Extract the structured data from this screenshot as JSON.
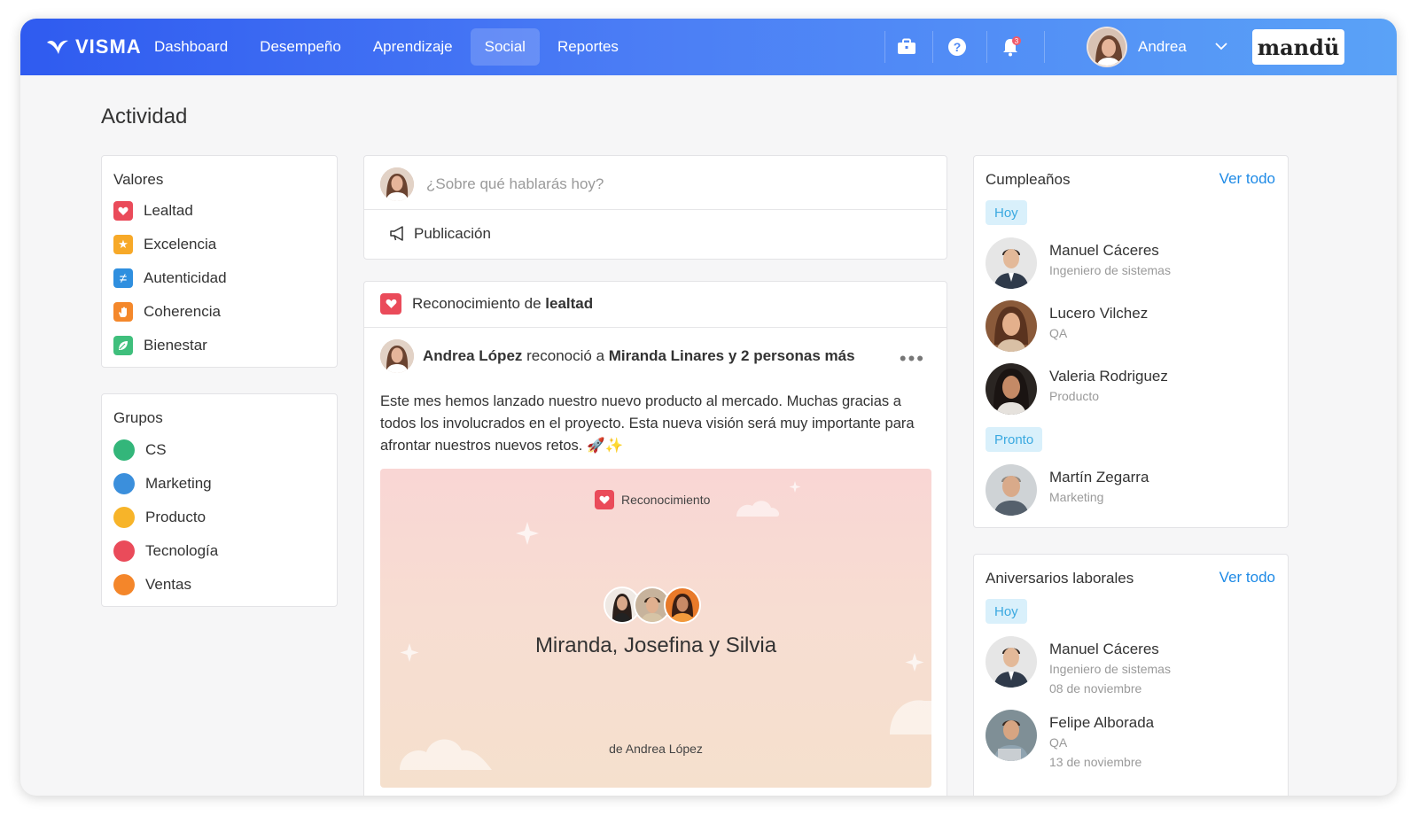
{
  "nav": {
    "brand": "VISMA",
    "links": [
      {
        "label": "Dashboard"
      },
      {
        "label": "Desempeño"
      },
      {
        "label": "Aprendizaje"
      },
      {
        "label": "Social"
      },
      {
        "label": "Reportes"
      }
    ],
    "active": "Social",
    "notification_count": "3",
    "user_name": "Andrea",
    "partner_logo": "mandü"
  },
  "page": {
    "title": "Actividad"
  },
  "valores": {
    "title": "Valores",
    "items": [
      {
        "label": "Lealtad",
        "icon": "heart-icon",
        "color": "#ea4b5a"
      },
      {
        "label": "Excelencia",
        "icon": "star-icon",
        "color": "#f7a928"
      },
      {
        "label": "Autenticidad",
        "icon": "not-equal-icon",
        "color": "#2f8fdf"
      },
      {
        "label": "Coherencia",
        "icon": "hand-icon",
        "color": "#f4882b"
      },
      {
        "label": "Bienestar",
        "icon": "leaf-icon",
        "color": "#3fbf7c"
      }
    ]
  },
  "grupos": {
    "title": "Grupos",
    "items": [
      {
        "label": "CS",
        "color": "#33b67a"
      },
      {
        "label": "Marketing",
        "color": "#3b8fdc"
      },
      {
        "label": "Producto",
        "color": "#f7b429"
      },
      {
        "label": "Tecnología",
        "color": "#ea4b5a"
      },
      {
        "label": "Ventas",
        "color": "#f4862a"
      }
    ]
  },
  "composer": {
    "placeholder": "¿Sobre qué hablarás hoy?",
    "action_label": "Publicación"
  },
  "post": {
    "header_prefix": "Reconocimiento de",
    "header_value": "lealtad",
    "author": "Andrea López",
    "verb": "reconoció a",
    "recipients": "Miranda Linares y 2 personas más",
    "more": "•••",
    "body": "Este mes hemos lanzado nuestro nuevo producto al mercado. Muchas gracias a todos los involucrados en el proyecto. Esta nueva visión será muy importante para afrontar nuestros nuevos retos. 🚀✨",
    "card": {
      "tag": "Reconocimiento",
      "names": "Miranda, Josefina y Silvia",
      "from": "de Andrea López"
    }
  },
  "cumpleanos": {
    "title": "Cumpleaños",
    "see_all": "Ver todo",
    "today_label": "Hoy",
    "soon_label": "Pronto",
    "today": [
      {
        "name": "Manuel Cáceres",
        "role": "Ingeniero de sistemas"
      },
      {
        "name": "Lucero Vilchez",
        "role": "QA"
      },
      {
        "name": "Valeria Rodriguez",
        "role": "Producto"
      }
    ],
    "soon": [
      {
        "name": "Martín Zegarra",
        "role": "Marketing"
      }
    ]
  },
  "aniversarios": {
    "title": "Aniversarios laborales",
    "see_all": "Ver todo",
    "today_label": "Hoy",
    "items": [
      {
        "name": "Manuel Cáceres",
        "role": "Ingeniero de sistemas",
        "date": "08 de noviembre"
      },
      {
        "name": "Felipe Alborada",
        "role": "QA",
        "date": "13 de noviembre"
      }
    ]
  }
}
